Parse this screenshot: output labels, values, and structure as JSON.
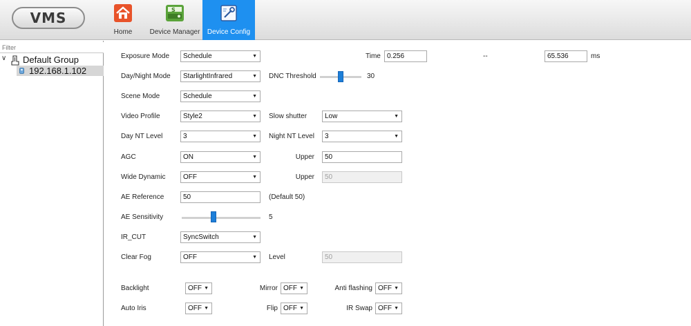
{
  "app": {
    "logo": "VMS"
  },
  "nav": {
    "home": "Home",
    "device_manager": "Device Manager",
    "device_config": "Device Config",
    "active_color": "#1e90f0"
  },
  "sidebar": {
    "filter_placeholder": "Filter",
    "group_label": "Default Group",
    "device_label": "192.168.1.102"
  },
  "form": {
    "exposure_mode": {
      "label": "Exposure Mode",
      "value": "Schedule"
    },
    "time": {
      "label": "Time",
      "min": "0.256",
      "separator": "--",
      "max": "65.536",
      "unit": "ms"
    },
    "day_night_mode": {
      "label": "Day/Night Mode",
      "value": "StarlightInfrared"
    },
    "dnc_threshold": {
      "label": "DNC Threshold",
      "value": "30",
      "fraction": 0.5
    },
    "scene_mode": {
      "label": "Scene Mode",
      "value": "Schedule"
    },
    "video_profile": {
      "label": "Video Profile",
      "value": "Style2"
    },
    "slow_shutter": {
      "label": "Slow shutter",
      "value": "Low"
    },
    "day_nt_level": {
      "label": "Day NT Level",
      "value": "3"
    },
    "night_nt_level": {
      "label": "Night NT Level",
      "value": "3"
    },
    "agc": {
      "label": "AGC",
      "value": "ON"
    },
    "agc_upper": {
      "label": "Upper",
      "value": "50"
    },
    "wide_dynamic": {
      "label": "Wide Dynamic",
      "value": "OFF"
    },
    "wd_upper": {
      "label": "Upper",
      "value": "50"
    },
    "ae_reference": {
      "label": "AE Reference",
      "value": "50",
      "hint": "(Default 50)"
    },
    "ae_sensitivity": {
      "label": "AE Sensitivity",
      "value": "5",
      "fraction": 0.4
    },
    "ir_cut": {
      "label": "IR_CUT",
      "value": "SyncSwitch"
    },
    "clear_fog": {
      "label": "Clear Fog",
      "value": "OFF"
    },
    "fog_level": {
      "label": "Level",
      "value": "50"
    },
    "backlight": {
      "label": "Backlight",
      "value": "OFF"
    },
    "mirror": {
      "label": "Mirror",
      "value": "OFF"
    },
    "anti_flashing": {
      "label": "Anti flashing",
      "value": "OFF"
    },
    "auto_iris": {
      "label": "Auto Iris",
      "value": "OFF"
    },
    "flip": {
      "label": "Flip",
      "value": "OFF"
    },
    "ir_swap": {
      "label": "IR Swap",
      "value": "OFF"
    }
  }
}
